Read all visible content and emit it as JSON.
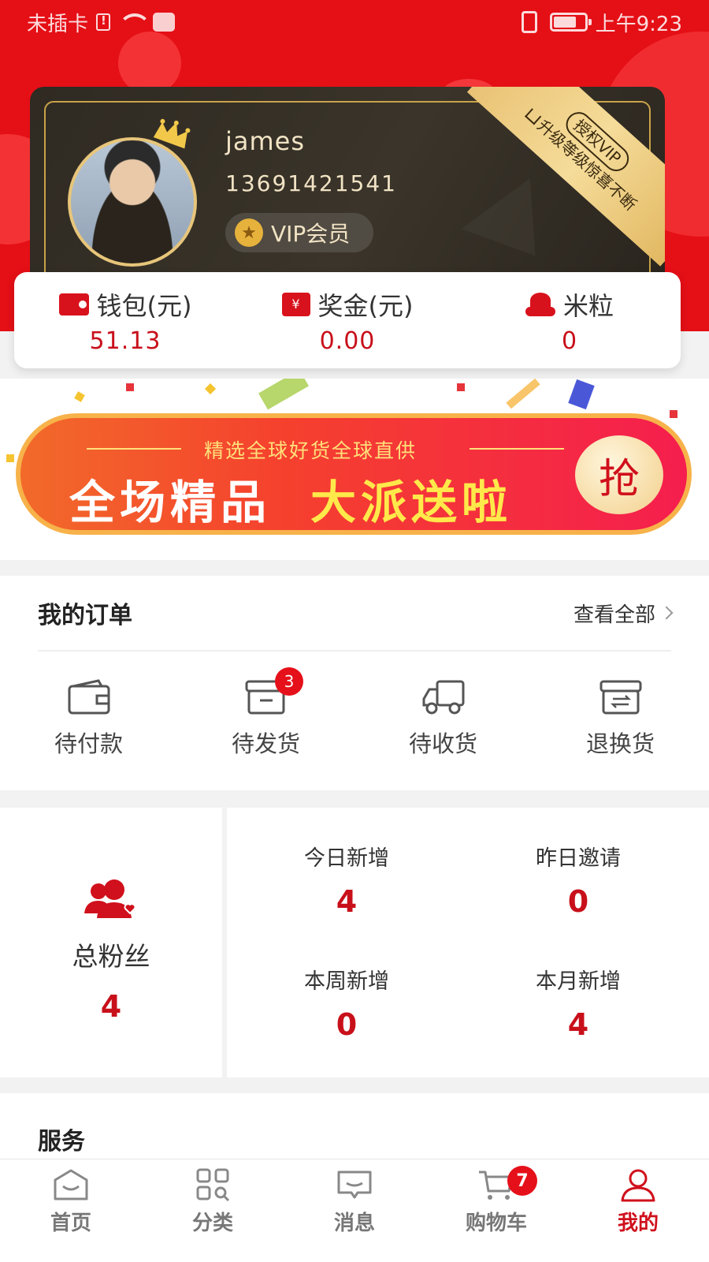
{
  "status_bar": {
    "carrier": "未插卡",
    "time": "上午9:23",
    "icons": [
      "sim-alert-icon",
      "wifi-icon",
      "huawei-icon",
      "vibrate-icon",
      "battery-icon"
    ]
  },
  "user": {
    "name": "james",
    "phone": "13691421541",
    "level_label": "VIP会员",
    "vip_ribbon_title": "授权VIP",
    "vip_ribbon_slogan": "升级等级惊喜不断"
  },
  "wallet": {
    "items": [
      {
        "label": "钱包(元)",
        "value": "51.13",
        "icon": "wallet-icon"
      },
      {
        "label": "奖金(元)",
        "value": "0.00",
        "icon": "bonus-icon"
      },
      {
        "label": "米粒",
        "value": "0",
        "icon": "rice-icon"
      }
    ]
  },
  "banner": {
    "subtitle": "精选全球好货全球直供",
    "main_white": "全场精品",
    "main_yellow": "大派送啦",
    "button": "抢"
  },
  "orders": {
    "title": "我的订单",
    "view_all": "查看全部",
    "items": [
      {
        "label": "待付款",
        "icon": "wallet-outline-icon",
        "badge": ""
      },
      {
        "label": "待发货",
        "icon": "package-icon",
        "badge": "3"
      },
      {
        "label": "待收货",
        "icon": "truck-icon",
        "badge": ""
      },
      {
        "label": "退换货",
        "icon": "exchange-icon",
        "badge": ""
      }
    ]
  },
  "fans": {
    "title": "总粉丝",
    "total": "4",
    "stats": [
      {
        "label": "今日新增",
        "value": "4"
      },
      {
        "label": "昨日邀请",
        "value": "0"
      },
      {
        "label": "本周新增",
        "value": "0"
      },
      {
        "label": "本月新增",
        "value": "4"
      }
    ]
  },
  "services": {
    "title": "服务"
  },
  "tabbar": {
    "items": [
      {
        "label": "首页",
        "icon": "home-icon"
      },
      {
        "label": "分类",
        "icon": "category-icon"
      },
      {
        "label": "消息",
        "icon": "message-icon"
      },
      {
        "label": "购物车",
        "icon": "cart-icon",
        "badge": "7"
      },
      {
        "label": "我的",
        "icon": "profile-icon",
        "active": true
      }
    ]
  },
  "colors": {
    "brand_red": "#e50f16",
    "gold": "#e7c57a",
    "dark_card": "#2f2a22"
  }
}
